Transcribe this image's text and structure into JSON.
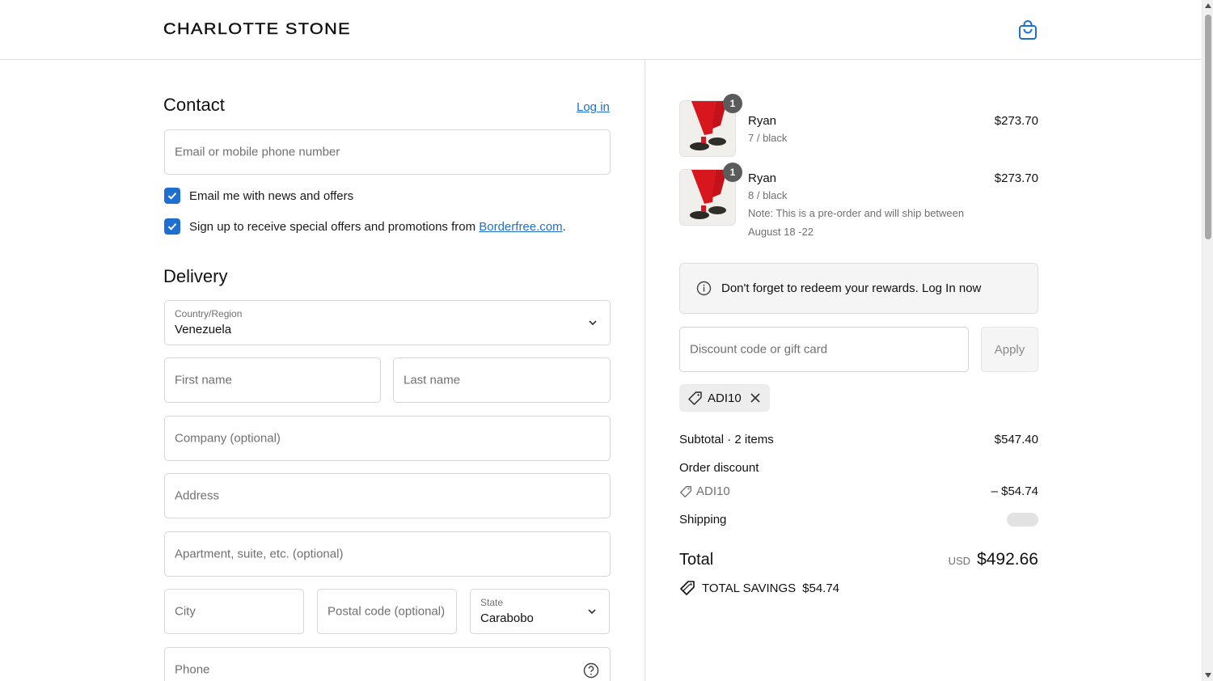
{
  "header": {
    "logo": "CHARLOTTE STONE",
    "cart_icon": "shopping-bag-icon",
    "accent_color": "#1f6fd1"
  },
  "contact": {
    "title": "Contact",
    "login_link": "Log in",
    "email_placeholder": "Email or mobile phone number",
    "checkbox_news": "Email me with news and offers",
    "checkbox_offers_prefix": "Sign up to receive special offers and promotions from ",
    "checkbox_offers_link": "Borderfree.com",
    "checkbox_offers_suffix": "."
  },
  "delivery": {
    "title": "Delivery",
    "country_label": "Country/Region",
    "country_value": "Venezuela",
    "first_name": "First name",
    "last_name": "Last name",
    "company": "Company (optional)",
    "address": "Address",
    "apartment": "Apartment, suite, etc. (optional)",
    "city": "City",
    "postal": "Postal code (optional)",
    "state_label": "State",
    "state_value": "Carabobo",
    "phone": "Phone"
  },
  "cart": {
    "items": [
      {
        "qty": "1",
        "name": "Ryan",
        "variant": "7 / black",
        "price": "$273.70",
        "note_line1": "",
        "note_line2": ""
      },
      {
        "qty": "1",
        "name": "Ryan",
        "variant": "8 / black",
        "price": "$273.70",
        "note_line1": "Note: This is a pre-order and will ship between",
        "note_line2": "August 18 -22"
      }
    ],
    "rewards_notice": "Don't forget to redeem your rewards. Log In now",
    "discount_placeholder": "Discount code or gift card",
    "apply_label": "Apply",
    "applied_code": "ADI10"
  },
  "summary": {
    "subtotal_label": "Subtotal · 2 items",
    "subtotal_value": "$547.40",
    "order_discount_label": "Order discount",
    "discount_code": "ADI10",
    "discount_value": "– $54.74",
    "shipping_label": "Shipping",
    "total_label": "Total",
    "currency": "USD",
    "total_value": "$492.66",
    "savings_label": "TOTAL SAVINGS",
    "savings_value": "$54.74"
  }
}
